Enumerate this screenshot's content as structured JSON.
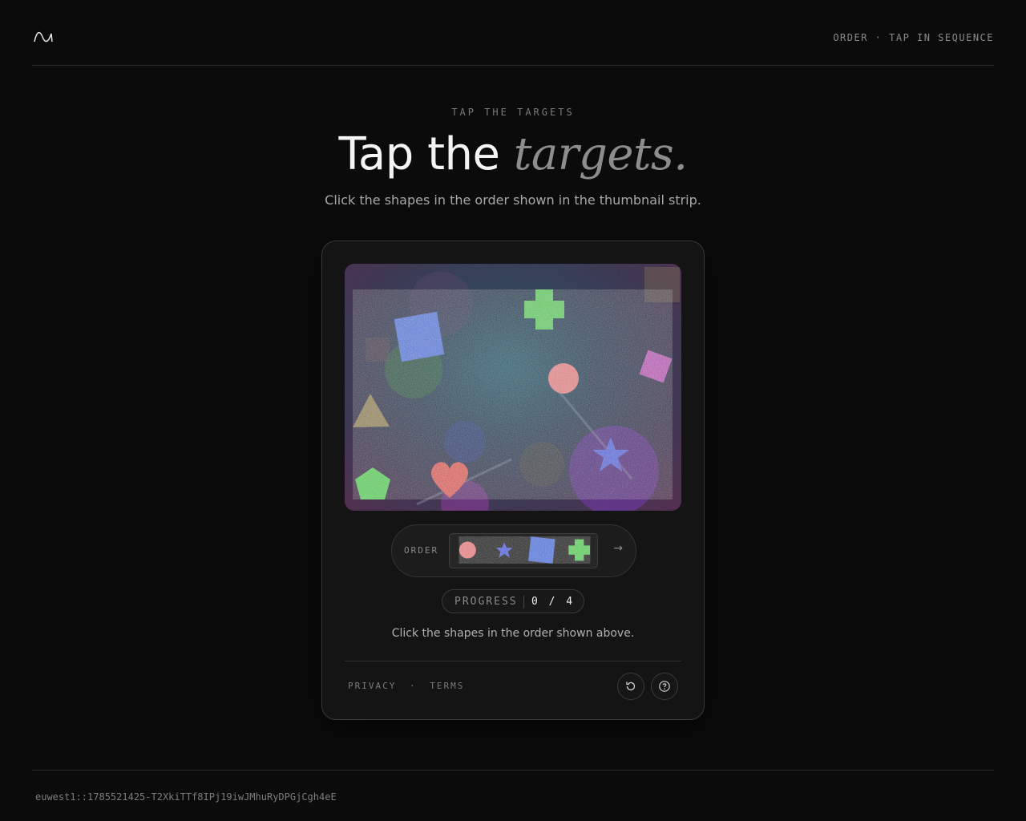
{
  "header": {
    "logo_icon": "wave-logo-icon",
    "right_text": "ORDER · TAP IN SEQUENCE"
  },
  "hero": {
    "eyebrow": "TAP THE TARGETS",
    "title_plain": "Tap the",
    "title_emphasis": "targets.",
    "subtitle": "Click the shapes in the order shown in the thumbnail strip."
  },
  "challenge": {
    "canvas_shapes": [
      "blue-square",
      "green-cross",
      "magenta-diamond",
      "pink-circle",
      "olive-triangle",
      "blue-star",
      "red-heart",
      "green-pentagon"
    ],
    "order_label": "ORDER",
    "order_sequence": [
      "pink-circle",
      "blue-star",
      "blue-square",
      "green-cross"
    ],
    "next_icon": "arrow-right-icon",
    "progress_label": "PROGRESS",
    "progress_value": "0 / 4",
    "progress_done": 0,
    "progress_total": 4,
    "instruction": "Click the shapes in the order shown above."
  },
  "card_footer": {
    "privacy": "PRIVACY",
    "separator": "·",
    "terms": "TERMS",
    "reload_icon": "reload-icon",
    "help_icon": "help-icon"
  },
  "footer": {
    "session_id": "euwest1::1785521425-T2XkiTTf8IPj19iwJMhuRyDPGjCgh4eE"
  },
  "colors": {
    "background": "#0b0b0b",
    "card": "#141414",
    "pink": "#e07a7a",
    "blue": "#3f6fd8",
    "green": "#4cc84a",
    "magenta": "#b43cb0"
  }
}
